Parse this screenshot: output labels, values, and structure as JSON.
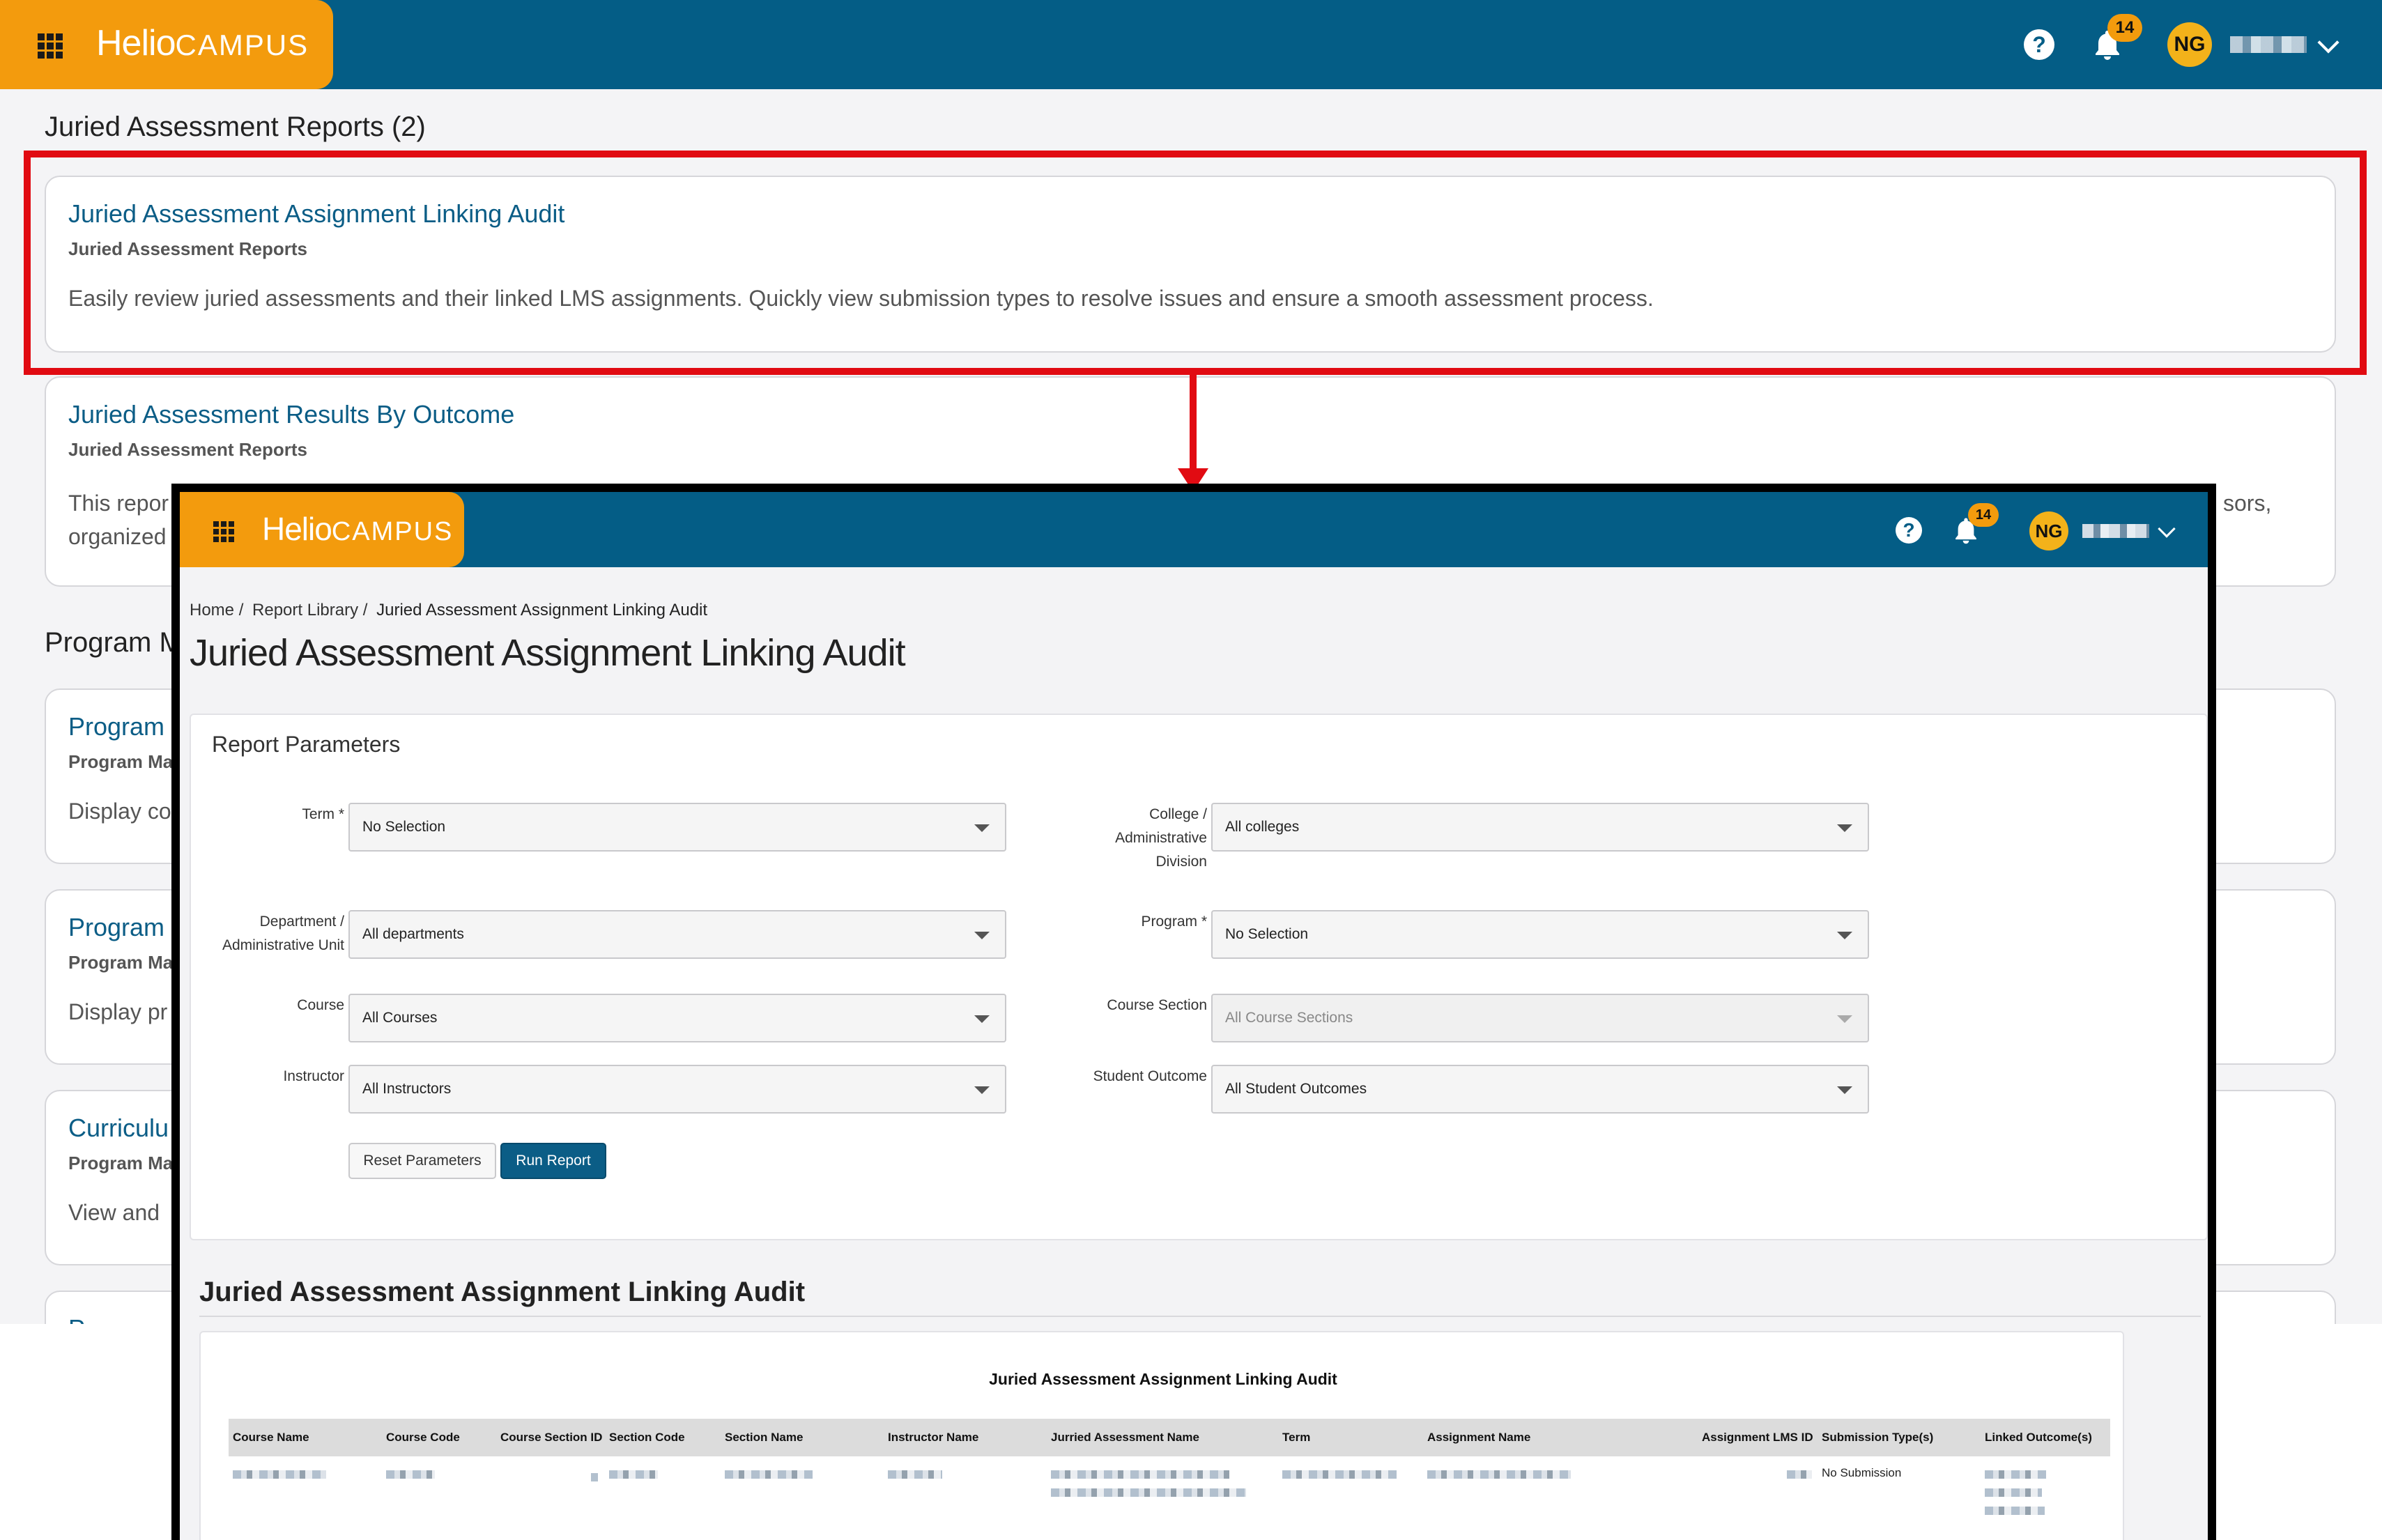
{
  "app": {
    "logo_main": "Helio",
    "logo_sub": "CAMPUS",
    "notifications_count": "14",
    "user_initials": "NG",
    "help_glyph": "?"
  },
  "library": {
    "section_title": "Juried Assessment Reports (2)",
    "cards": [
      {
        "title": "Juried Assessment Assignment Linking Audit",
        "category": "Juried Assessment Reports",
        "description": "Easily review juried assessments and their linked LMS assignments. Quickly view submission types to resolve issues and ensure a smooth assessment process."
      },
      {
        "title": "Juried Assessment Results By Outcome",
        "category": "Juried Assessment Reports",
        "description_left": "This repor",
        "description_left2": "organized",
        "description_right": "sors,"
      },
      {
        "title": "Program",
        "category": "Program Ma",
        "description": "Display co"
      },
      {
        "title": "Program",
        "category": "Program Ma",
        "description": "Display pr"
      },
      {
        "title": "Curriculu",
        "category": "Program Ma",
        "description": "View and"
      },
      {
        "title": "P",
        "category": "",
        "description": ""
      }
    ],
    "second_section_title": "Program M"
  },
  "report": {
    "breadcrumb": [
      "Home /",
      "Report Library /",
      "Juried Assessment Assignment Linking Audit"
    ],
    "page_title": "Juried Assessment Assignment Linking Audit",
    "params_title": "Report Parameters",
    "fields": {
      "term": {
        "label": "Term *",
        "value": "No Selection"
      },
      "college": {
        "label_1": "College /",
        "label_2": "Administrative",
        "label_3": "Division",
        "value": "All colleges"
      },
      "department": {
        "label_1": "Department /",
        "label_2": "Administrative Unit",
        "value": "All departments"
      },
      "program": {
        "label": "Program *",
        "value": "No Selection"
      },
      "course": {
        "label": "Course",
        "value": "All Courses"
      },
      "course_section": {
        "label": "Course Section",
        "value": "All Course Sections"
      },
      "instructor": {
        "label": "Instructor",
        "value": "All Instructors"
      },
      "student_outcome": {
        "label": "Student Outcome",
        "value": "All Student Outcomes"
      }
    },
    "buttons": {
      "reset": "Reset Parameters",
      "run": "Run Report"
    },
    "results_title": "Juried Assessment Assignment Linking Audit",
    "table_title": "Juried Assessment Assignment Linking Audit",
    "columns": [
      "Course Name",
      "Course Code",
      "Course Section ID",
      "Section Code",
      "Section Name",
      "Instructor Name",
      "Jurried Assessment Name",
      "Term",
      "Assignment Name",
      "Assignment LMS ID",
      "Submission Type(s)",
      "Linked Outcome(s)"
    ],
    "row": {
      "submission_type": "No Submission"
    }
  },
  "colors": {
    "header_blue": "#045d86",
    "brand_orange": "#f39b0d",
    "highlight_red": "#e10b12",
    "link_blue": "#0b5d86"
  }
}
